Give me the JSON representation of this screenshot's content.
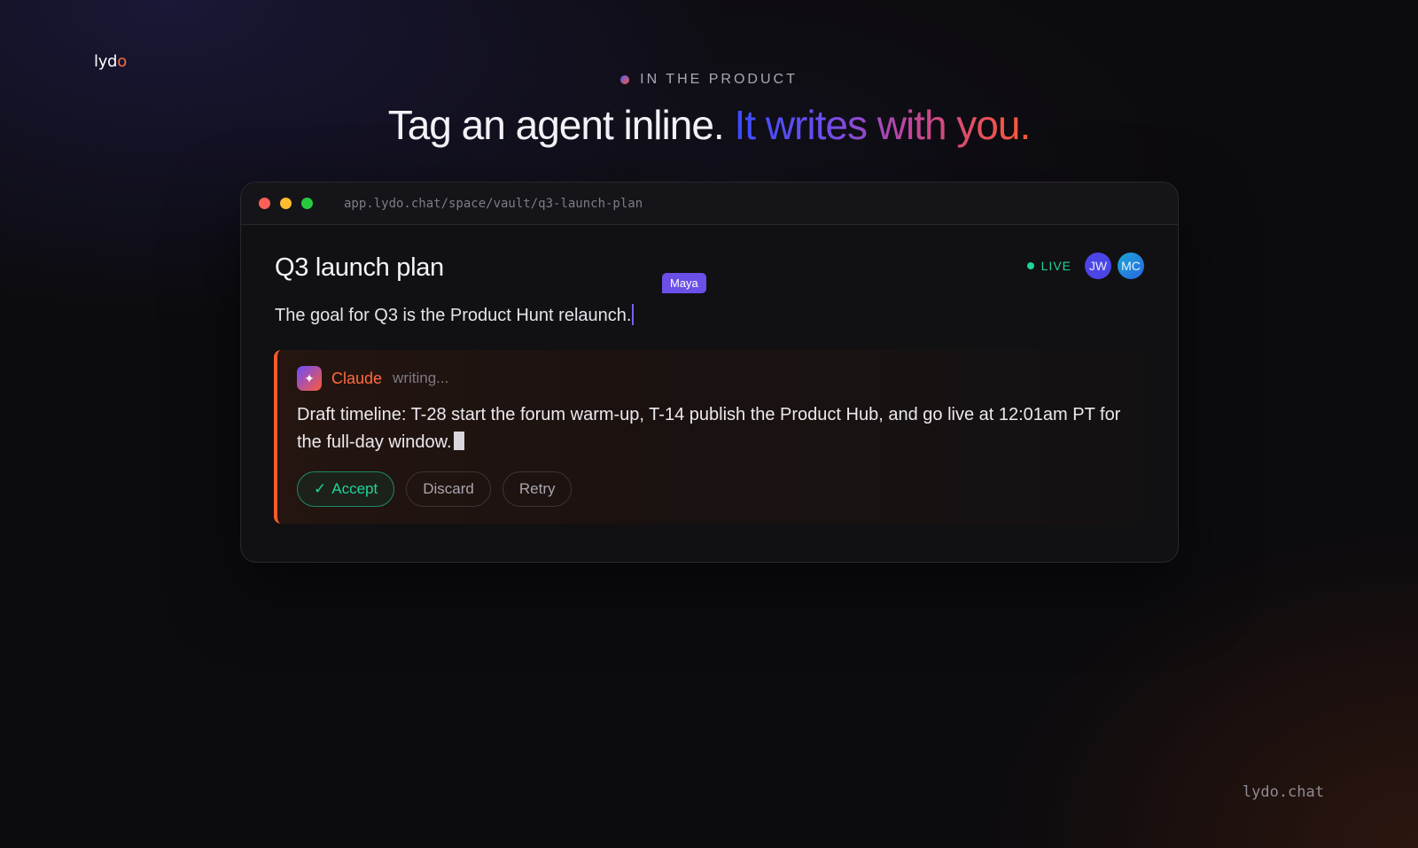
{
  "brand": {
    "logo_main": "lyd",
    "logo_o": "o",
    "footer_url": "lydo.chat"
  },
  "hero": {
    "eyebrow": "IN THE PRODUCT",
    "headline_plain": "Tag an agent inline.",
    "headline_gradient": "It writes with you."
  },
  "window": {
    "url": "app.lydo.chat/space/vault/q3-launch-plan",
    "doc_title": "Q3 launch plan",
    "presence": {
      "live_label": "LIVE",
      "avatars": [
        "JW",
        "MC"
      ]
    },
    "paragraph": "The goal for Q3 is the Product Hunt relaunch.",
    "cursor_user": "Maya",
    "agent": {
      "name": "Claude",
      "status": "writing...",
      "badge_icon": "✦",
      "text": "Draft timeline: T-28 start the forum warm-up, T-14 publish the Product Hub, and go live at 12:01am PT for the full-day window.",
      "actions": {
        "accept_check": "✓",
        "accept": "Accept",
        "discard": "Discard",
        "retry": "Retry"
      }
    }
  },
  "colors": {
    "accent_orange": "#ff5a2a",
    "live_green": "#1fd39a",
    "cursor_purple": "#6b4fe6"
  }
}
